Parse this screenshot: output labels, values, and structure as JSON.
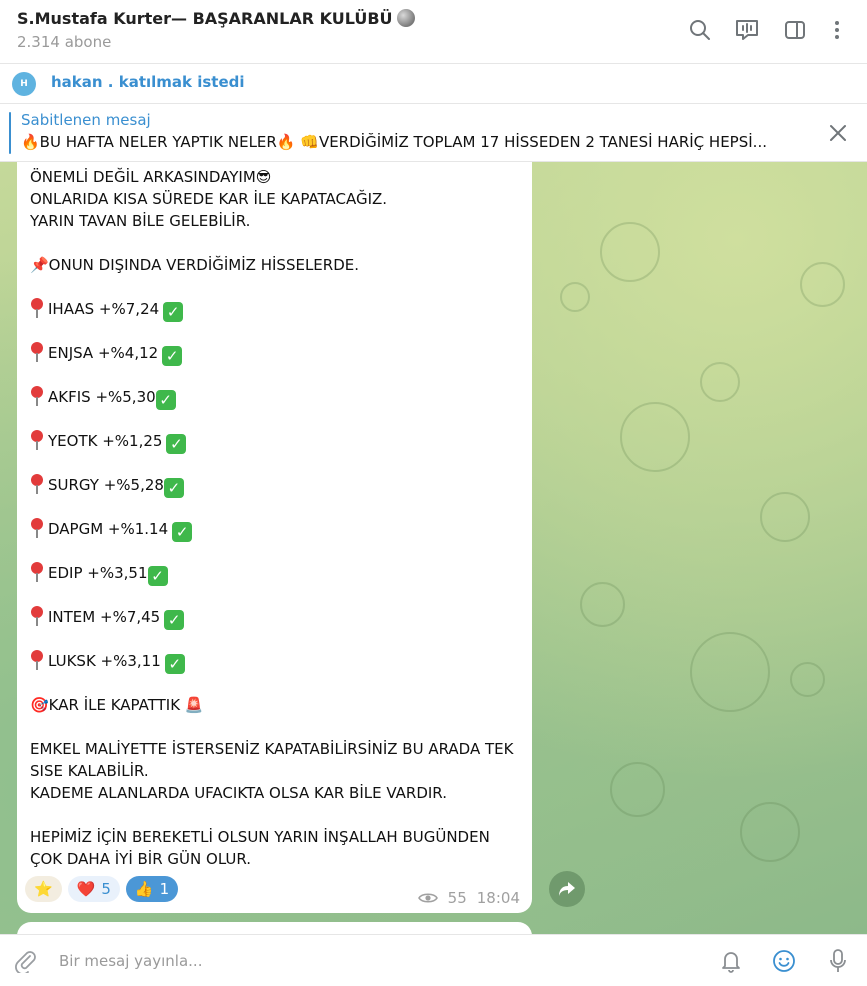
{
  "header": {
    "title": "S.Mustafa Kurter— BAŞARANLAR KULÜBÜ",
    "subscribers": "2.314 abone"
  },
  "join_request": {
    "avatar_letter": "H",
    "text": "hakan . katılmak istedi"
  },
  "pinned": {
    "label": "Sabitlenen mesaj",
    "text": "🔥BU HAFTA NELER YAPTIK NELER🔥  👊VERDİĞİMİZ TOPLAM  17  HİSSEDEN 2 TANESİ HARİÇ HEPSİ..."
  },
  "message": {
    "intro": [
      "ÖNEMLİ DEĞİL ARKASINDAYIM😎",
      "ONLARIDA KISA SÜREDE KAR İLE KAPATACAĞIZ.",
      "YARIN TAVAN BİLE GELEBİLİR."
    ],
    "section_title": "📌ONUN DIŞINDA VERDİĞİMİZ HİSSELERDE.",
    "stocks": [
      {
        "name": "IHAAS +%7,24"
      },
      {
        "name": "ENJSA +%4,12"
      },
      {
        "name": "AKFIS +%5,30"
      },
      {
        "name": "YEOTK +%1,25"
      },
      {
        "name": "SURGY +%5,28"
      },
      {
        "name": "DAPGM +%1.14"
      },
      {
        "name": "EDIP +%3,51"
      },
      {
        "name": "INTEM +%7,45"
      },
      {
        "name": "LUKSK +%3,11"
      }
    ],
    "closing_line": "🎯KAR İLE KAPATTIK 🚨",
    "paragraph1": [
      "EMKEL MALİYETTE İSTERSENİZ KAPATABİLİRSİNİZ BU ARADA TEK",
      "SISE KALABİLİR.",
      "KADEME ALANLARDA UFACIKTA OLSA KAR BİLE VARDIR."
    ],
    "paragraph2": [
      "HEPİMİZ İÇİN BEREKETLİ OLSUN YARIN İNŞALLAH BUGÜNDEN",
      "ÇOK DAHA İYİ BİR GÜN OLUR."
    ],
    "reactions": [
      {
        "emoji": "⭐",
        "count": ""
      },
      {
        "emoji": "❤️",
        "count": "5"
      },
      {
        "emoji": "👍",
        "count": "1"
      }
    ],
    "views": "55",
    "time": "18:04"
  },
  "input": {
    "placeholder": "Bir mesaj yayınla..."
  },
  "icons": [
    "search-icon",
    "live-stream-icon",
    "sidebar-toggle-icon",
    "more-icon",
    "close-icon",
    "share-icon",
    "attach-icon",
    "bell-icon",
    "emoji-icon",
    "mic-icon",
    "eye-icon"
  ],
  "colors": {
    "accent": "#3a8fd0",
    "check": "#3fb84b",
    "pin": "#e23b3b",
    "thumb_reaction": "#4b97d6"
  }
}
